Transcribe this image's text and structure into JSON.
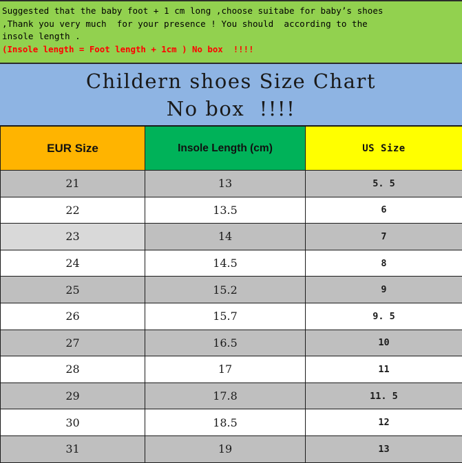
{
  "notice": {
    "lines": [
      "Suggested that the baby foot + 1 cm long ,choose suitabe for baby’s shoes",
      ",Thank you very much  for your presence ! You should  according to the",
      "insole length ."
    ],
    "red_line": "(Insole length = Foot length + 1cm ) No box  !!!!",
    "background_color": "#92d14f",
    "red_color": "#ff0000"
  },
  "title": {
    "line1": "Childern shoes Size Chart",
    "line2": "No box  !!!!",
    "background_color": "#8eb4e3"
  },
  "chart_data": {
    "type": "table",
    "title": "Childern shoes Size Chart",
    "columns": [
      {
        "label": "EUR Size",
        "header_color": "#ffb400"
      },
      {
        "label": "Insole Length (cm)",
        "header_color": "#00b259"
      },
      {
        "label": "US Size",
        "header_color": "#ffff00"
      }
    ],
    "rows": [
      {
        "eur": "21",
        "insole": "13",
        "us": "5. 5",
        "shaded": true,
        "first_cell_light": false
      },
      {
        "eur": "22",
        "insole": "13.5",
        "us": "6",
        "shaded": false,
        "first_cell_light": false
      },
      {
        "eur": "23",
        "insole": "14",
        "us": "7",
        "shaded": true,
        "first_cell_light": true
      },
      {
        "eur": "24",
        "insole": "14.5",
        "us": "8",
        "shaded": false,
        "first_cell_light": false
      },
      {
        "eur": "25",
        "insole": "15.2",
        "us": "9",
        "shaded": true,
        "first_cell_light": false
      },
      {
        "eur": "26",
        "insole": "15.7",
        "us": "9. 5",
        "shaded": false,
        "first_cell_light": false
      },
      {
        "eur": "27",
        "insole": "16.5",
        "us": "10",
        "shaded": true,
        "first_cell_light": false
      },
      {
        "eur": "28",
        "insole": "17",
        "us": "11",
        "shaded": false,
        "first_cell_light": false
      },
      {
        "eur": "29",
        "insole": "17.8",
        "us": "11. 5",
        "shaded": true,
        "first_cell_light": false
      },
      {
        "eur": "30",
        "insole": "18.5",
        "us": "12",
        "shaded": false,
        "first_cell_light": false
      },
      {
        "eur": "31",
        "insole": "19",
        "us": "13",
        "shaded": true,
        "first_cell_light": false
      }
    ],
    "row_shade_color": "#bfbfbf",
    "row_plain_color": "#ffffff",
    "row_light_color": "#d9d9d9"
  }
}
